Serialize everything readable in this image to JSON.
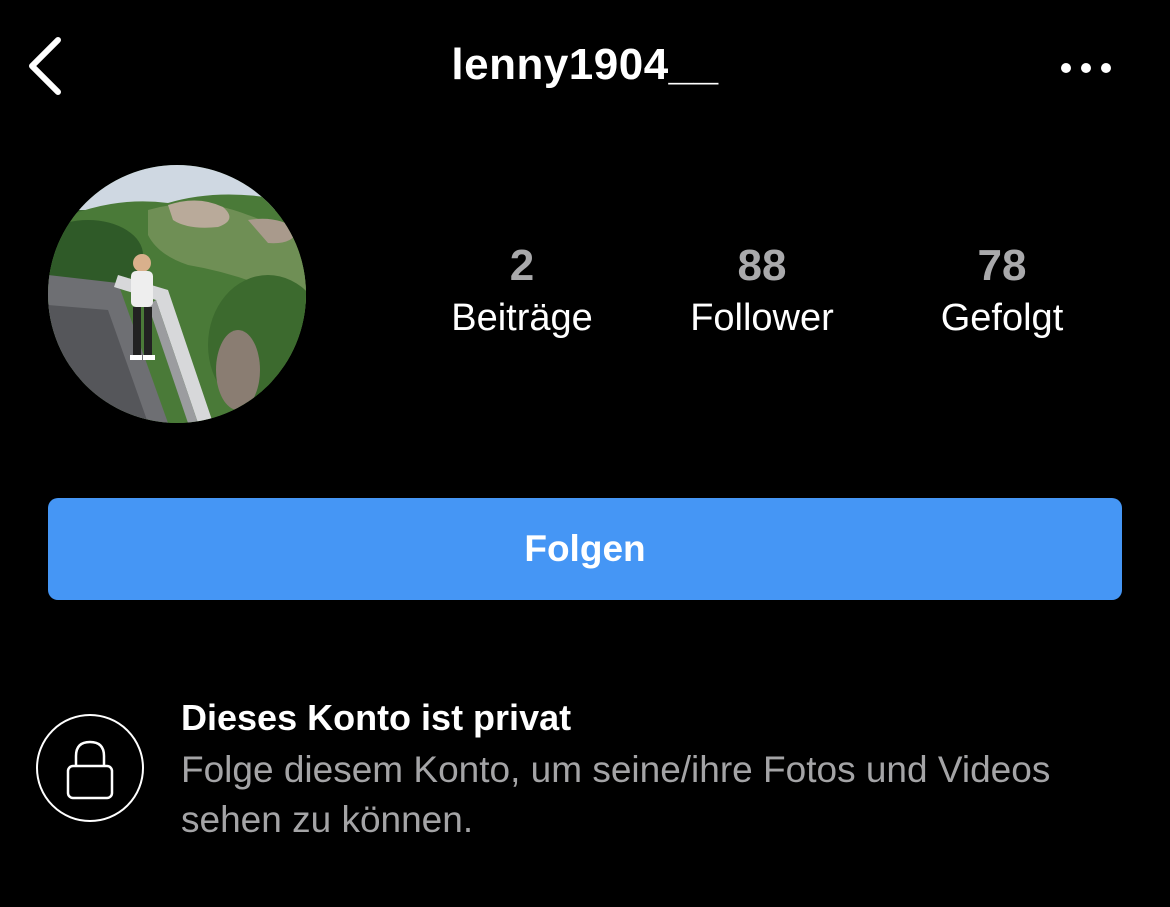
{
  "header": {
    "title": "lenny1904__",
    "back_icon": "chevron-left-icon",
    "more_icon": "ellipsis-icon"
  },
  "profile": {
    "avatar": "profile-photo-landscape"
  },
  "stats": [
    {
      "count": "2",
      "label": "Beiträge"
    },
    {
      "count": "88",
      "label": "Follower"
    },
    {
      "count": "78",
      "label": "Gefolgt"
    }
  ],
  "follow_button": {
    "label": "Folgen",
    "color": "#4596f5"
  },
  "private_notice": {
    "icon": "lock-icon",
    "title": "Dieses Konto ist privat",
    "description": "Folge diesem Konto, um seine/ihre Fotos und Videos sehen zu können."
  }
}
